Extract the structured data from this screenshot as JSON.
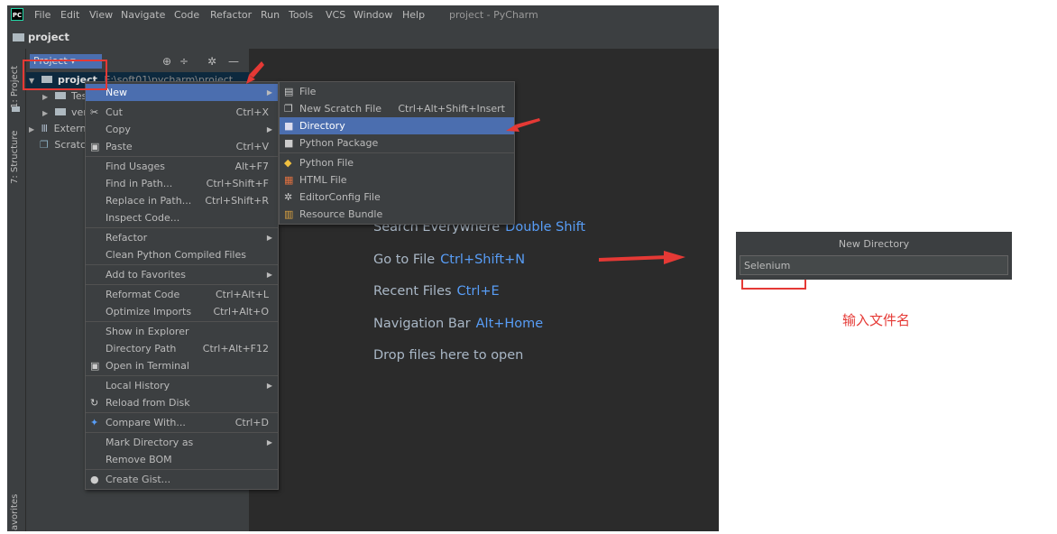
{
  "window": {
    "title": "project - PyCharm",
    "logo": "PC",
    "menu": [
      "File",
      "Edit",
      "View",
      "Navigate",
      "Code",
      "Refactor",
      "Run",
      "Tools",
      "VCS",
      "Window",
      "Help"
    ]
  },
  "navbar": {
    "project": "project"
  },
  "side_tabs": {
    "project": "1: Project",
    "structure": "7: Structure",
    "favorites": "avorites"
  },
  "project_panel": {
    "title": "Project ▾",
    "tree": [
      {
        "label": "project",
        "detail": "E:\\soft01\\pycharm\\project",
        "selected": true
      },
      {
        "label": "Tes"
      },
      {
        "label": "ver"
      },
      {
        "label": "Extern"
      },
      {
        "label": "Scratc"
      }
    ]
  },
  "welcome": {
    "items": [
      {
        "text": "Search Everywhere",
        "key": "Double Shift"
      },
      {
        "text": "Go to File",
        "key": "Ctrl+Shift+N"
      },
      {
        "text": "Recent Files",
        "key": "Ctrl+E"
      },
      {
        "text": "Navigation Bar",
        "key": "Alt+Home"
      },
      {
        "text": "Drop files here to open",
        "key": ""
      }
    ]
  },
  "context_menu": {
    "items": [
      {
        "label": "New",
        "shortcut": "",
        "submenu": true,
        "highlight": true,
        "icon": ""
      },
      {
        "label": "Cut",
        "shortcut": "Ctrl+X",
        "icon": "scissors-icon"
      },
      {
        "label": "Copy",
        "shortcut": "",
        "submenu": true
      },
      {
        "label": "Paste",
        "shortcut": "Ctrl+V",
        "icon": "clipboard-icon"
      },
      {
        "label": "Find Usages",
        "shortcut": "Alt+F7"
      },
      {
        "label": "Find in Path...",
        "shortcut": "Ctrl+Shift+F"
      },
      {
        "label": "Replace in Path...",
        "shortcut": "Ctrl+Shift+R"
      },
      {
        "label": "Inspect Code...",
        "shortcut": ""
      },
      {
        "label": "Refactor",
        "shortcut": "",
        "submenu": true
      },
      {
        "label": "Clean Python Compiled Files",
        "shortcut": ""
      },
      {
        "label": "Add to Favorites",
        "shortcut": "",
        "submenu": true
      },
      {
        "label": "Reformat Code",
        "shortcut": "Ctrl+Alt+L"
      },
      {
        "label": "Optimize Imports",
        "shortcut": "Ctrl+Alt+O"
      },
      {
        "label": "Show in Explorer",
        "shortcut": ""
      },
      {
        "label": "Directory Path",
        "shortcut": "Ctrl+Alt+F12"
      },
      {
        "label": "Open in Terminal",
        "shortcut": "",
        "icon": "terminal-icon"
      },
      {
        "label": "Local History",
        "shortcut": "",
        "submenu": true
      },
      {
        "label": "Reload from Disk",
        "shortcut": "",
        "icon": "reload-icon"
      },
      {
        "label": "Compare With...",
        "shortcut": "Ctrl+D",
        "icon": "compare-icon"
      },
      {
        "label": "Mark Directory as",
        "shortcut": "",
        "submenu": true
      },
      {
        "label": "Remove BOM",
        "shortcut": ""
      },
      {
        "label": "Create Gist...",
        "shortcut": "",
        "icon": "github-icon"
      }
    ]
  },
  "new_submenu": {
    "items": [
      {
        "label": "File",
        "shortcut": "",
        "icon": "file-icon"
      },
      {
        "label": "New Scratch File",
        "shortcut": "Ctrl+Alt+Shift+Insert",
        "icon": "scratch-file-icon"
      },
      {
        "label": "Directory",
        "shortcut": "",
        "highlight": true,
        "icon": "folder-icon"
      },
      {
        "label": "Python Package",
        "shortcut": "",
        "icon": "package-icon"
      },
      {
        "label": "Python File",
        "shortcut": "",
        "icon": "python-icon"
      },
      {
        "label": "HTML File",
        "shortcut": "",
        "icon": "html-icon"
      },
      {
        "label": "EditorConfig File",
        "shortcut": "",
        "icon": "gear-icon"
      },
      {
        "label": "Resource Bundle",
        "shortcut": "",
        "icon": "bundle-icon"
      }
    ]
  },
  "dialog": {
    "title": "New Directory",
    "value": "Selenium"
  },
  "caption": "输入文件名",
  "colors": {
    "accent": "#4b6eaf",
    "annotation": "#e53935",
    "link": "#589df6"
  }
}
